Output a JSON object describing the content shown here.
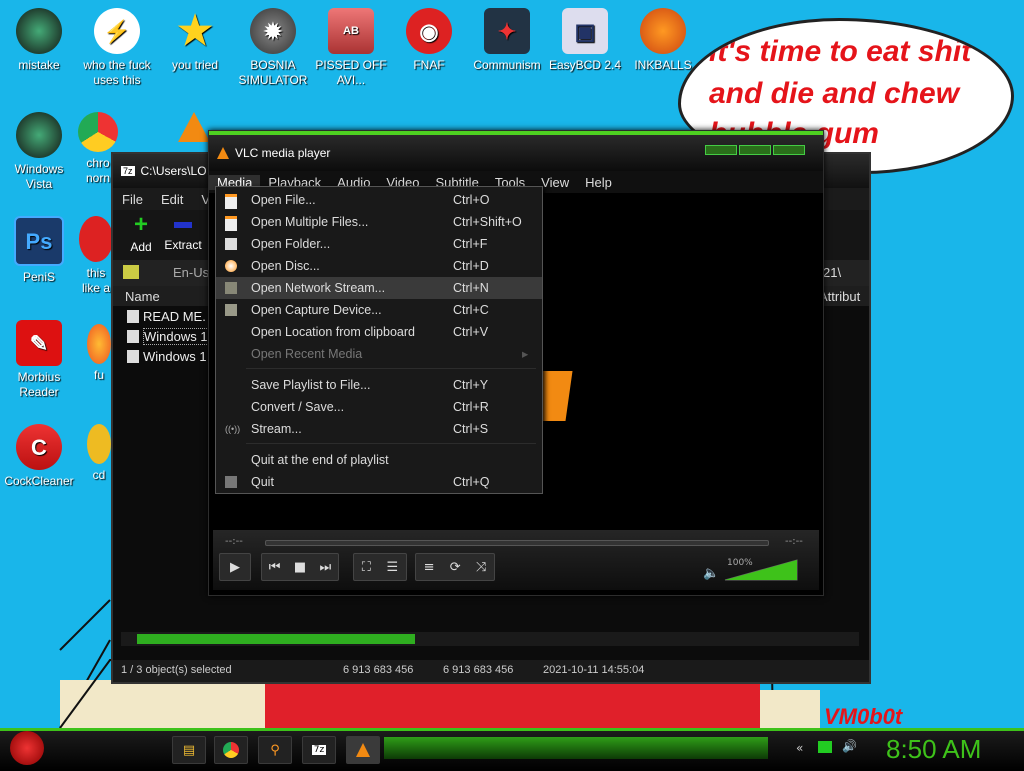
{
  "desktop": {
    "icons": [
      {
        "label": "mistake",
        "icon": "green-orb-icon"
      },
      {
        "label": "who the fuck uses this",
        "icon": "lightning-icon"
      },
      {
        "label": "you tried",
        "icon": "star-icon"
      },
      {
        "label": "BOSNIA SIMULATOR",
        "icon": "mine-icon"
      },
      {
        "label": "PISSED OFF AVI...",
        "icon": "game-icon"
      },
      {
        "label": "FNAF",
        "icon": "angry-bird-icon"
      },
      {
        "label": "Communism",
        "icon": "emblem-icon"
      },
      {
        "label": "EasyBCD 2.4",
        "icon": "computer-icon"
      },
      {
        "label": "INKBALLS",
        "icon": "ball-icon"
      },
      {
        "label": "Windows Vista",
        "icon": "green-orb-icon"
      },
      {
        "label": "chro norn",
        "icon": "chrome-icon"
      },
      {
        "label": "PeniS",
        "icon": "photoshop-icon"
      },
      {
        "label": "this like a",
        "icon": "red-icon"
      },
      {
        "label": "Morbius Reader",
        "icon": "pdf-icon"
      },
      {
        "label": "fu",
        "icon": "firefox-icon"
      },
      {
        "label": "CockCleaner",
        "icon": "broom-icon"
      },
      {
        "label": "cd",
        "icon": "yellow-icon"
      }
    ],
    "bubble_lines": [
      "it's time to eat shit",
      "and die and chew",
      "bubble gum"
    ],
    "signature": "VM0b0t"
  },
  "zip_window": {
    "title": "C:\\Users\\LO",
    "menu": [
      "File",
      "Edit",
      "V"
    ],
    "toolbar": {
      "add": "Add",
      "extract": "Extract"
    },
    "address": "En-Us",
    "address_right": "21\\",
    "col_name": "Name",
    "col_attrib": "Attribut",
    "files": [
      "READ ME.",
      "Windows 1",
      "Windows 1"
    ],
    "status": {
      "selected": "1 / 3 object(s) selected",
      "size1": "6 913 683 456",
      "size2": "6 913 683 456",
      "date": "2021-10-11 14:55:04"
    }
  },
  "vlc": {
    "title": "VLC media player",
    "menubar": [
      "Media",
      "Playback",
      "Audio",
      "Video",
      "Subtitle",
      "Tools",
      "View",
      "Help"
    ],
    "media_menu": [
      {
        "label": "Open File...",
        "shortcut": "Ctrl+O",
        "icon": "file-icon"
      },
      {
        "label": "Open Multiple Files...",
        "shortcut": "Ctrl+Shift+O",
        "icon": "files-icon"
      },
      {
        "label": "Open Folder...",
        "shortcut": "Ctrl+F",
        "icon": "folder-icon"
      },
      {
        "label": "Open Disc...",
        "shortcut": "Ctrl+D",
        "icon": "disc-icon"
      },
      {
        "label": "Open Network Stream...",
        "shortcut": "Ctrl+N",
        "icon": "network-icon"
      },
      {
        "label": "Open Capture Device...",
        "shortcut": "Ctrl+C",
        "icon": "capture-icon"
      },
      {
        "label": "Open Location from clipboard",
        "shortcut": "Ctrl+V",
        "icon": ""
      },
      {
        "label": "Open Recent Media",
        "shortcut": "",
        "icon": ""
      },
      {
        "label": "Save Playlist to File...",
        "shortcut": "Ctrl+Y",
        "icon": ""
      },
      {
        "label": "Convert / Save...",
        "shortcut": "Ctrl+R",
        "icon": ""
      },
      {
        "label": "Stream...",
        "shortcut": "Ctrl+S",
        "icon": "stream-icon"
      },
      {
        "label": "Quit at the end of playlist",
        "shortcut": "",
        "icon": ""
      },
      {
        "label": "Quit",
        "shortcut": "Ctrl+Q",
        "icon": "quit-icon"
      }
    ],
    "time_left": "--:--",
    "time_right": "--:--",
    "volume": "100%",
    "volume_level": 1.0
  },
  "taskbar": {
    "clock": "8:50 AM"
  },
  "colors": {
    "desktop": "#19b6ea",
    "accent_green": "#3ec21a",
    "bubble_text": "#e5141a"
  }
}
